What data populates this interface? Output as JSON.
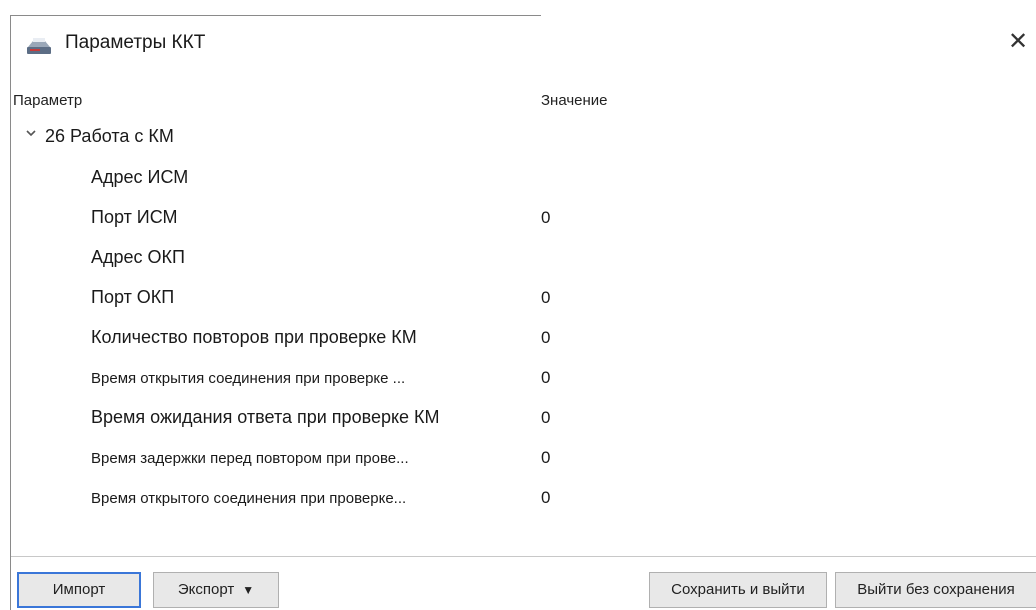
{
  "window": {
    "title": "Параметры ККТ",
    "close_glyph": "✕"
  },
  "grid": {
    "header_param": "Параметр",
    "header_value": "Значение",
    "group": {
      "chevron": "⌄",
      "label": "26 Работа с КМ"
    },
    "rows": [
      {
        "name": "Адрес ИСМ",
        "value": ""
      },
      {
        "name": "Порт ИСМ",
        "value": "0"
      },
      {
        "name": "Адрес ОКП",
        "value": ""
      },
      {
        "name": "Порт ОКП",
        "value": "0"
      },
      {
        "name": "Количество повторов при проверке КМ",
        "value": "0"
      },
      {
        "name": "Время открытия соединения при проверке ...",
        "value": "0"
      },
      {
        "name": "Время ожидания ответа при проверке КМ",
        "value": "0"
      },
      {
        "name": "Время задержки перед повтором при прове...",
        "value": "0"
      },
      {
        "name": "Время открытого соединения при проверке...",
        "value": "0"
      }
    ]
  },
  "buttons": {
    "import": "Импорт",
    "export": "Экспорт",
    "export_caret": "▼",
    "save_exit": "Сохранить и выйти",
    "exit_no_save": "Выйти без сохранения"
  },
  "icons": {
    "app": "printer-icon",
    "close": "close-icon",
    "chevron": "chevron-down-icon"
  }
}
